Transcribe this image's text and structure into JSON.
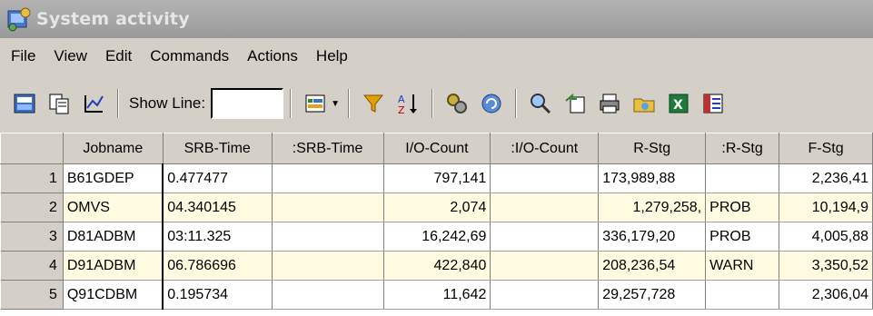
{
  "window": {
    "title": "System activity"
  },
  "menu": [
    "File",
    "View",
    "Edit",
    "Commands",
    "Actions",
    "Help"
  ],
  "toolbar": {
    "show_line_label": "Show Line:",
    "show_line_value": ""
  },
  "columns": [
    "",
    "Jobname",
    "SRB-Time",
    ":SRB-Time",
    "I/O-Count",
    ":I/O-Count",
    "R-Stg",
    ":R-Stg",
    "F-Stg"
  ],
  "rows": [
    [
      "1",
      "B61GDEP",
      "0.477477",
      "",
      "797,141",
      "",
      "173,989,88",
      "",
      "2,236,41"
    ],
    [
      "2",
      "OMVS",
      "04.340145",
      "",
      "2,074",
      "",
      "1,279,258,",
      "PROB",
      "10,194,9"
    ],
    [
      "3",
      "D81ADBM",
      "03:11.325",
      "",
      "16,242,69",
      "",
      "336,179,20",
      "PROB",
      "4,005,88"
    ],
    [
      "4",
      "D91ADBM",
      "06.786696",
      "",
      "422,840",
      "",
      "208,236,54",
      "WARN",
      "3,350,52"
    ],
    [
      "5",
      "Q91CDBM",
      "0.195734",
      "",
      "11,642",
      "",
      "29,257,728",
      "",
      "2,306,04"
    ]
  ]
}
